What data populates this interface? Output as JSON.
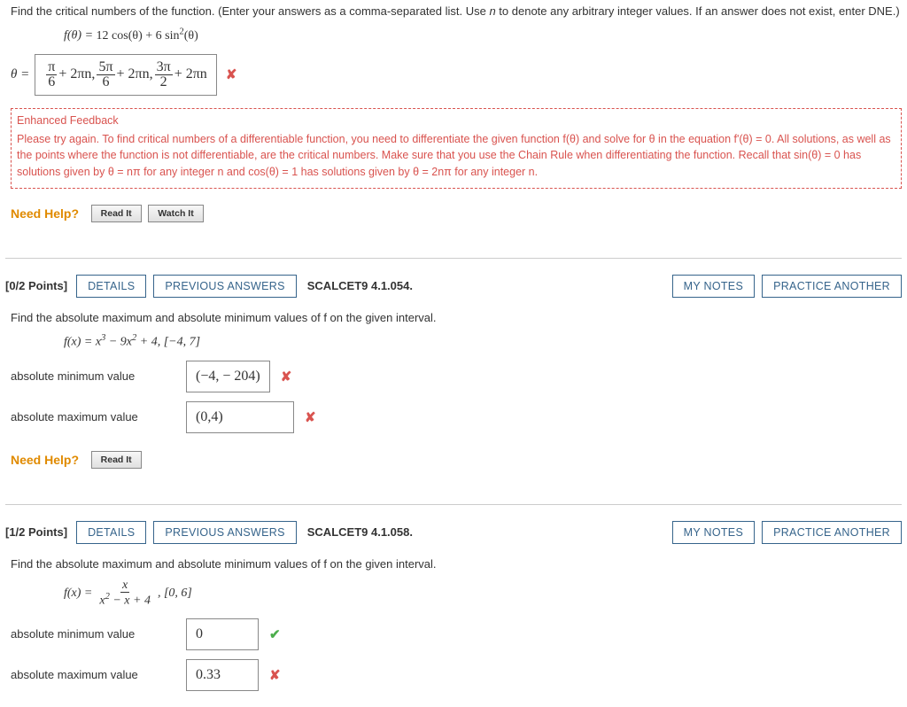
{
  "q1": {
    "prompt_a": "Find the critical numbers of the function. (Enter your answers as a comma-separated list. Use ",
    "prompt_n": "n",
    "prompt_b": " to denote any arbitrary integer values. If an answer does not exist, enter DNE.)",
    "func_fprefix": "f(θ) = ",
    "func_rest": "12 cos(θ) + 6 sin",
    "func_sup": "2",
    "func_tail": "(θ)",
    "theta_eq": "θ =",
    "ans_frac1_num": "π",
    "ans_frac1_den": "6",
    "ans_plus": " + 2πn, ",
    "ans_frac2_num": "5π",
    "ans_frac2_den": "6",
    "ans_frac3_num": "3π",
    "ans_frac3_den": "2",
    "ans_tail": " + 2πn",
    "feedback_title": "Enhanced Feedback",
    "feedback_body": "Please try again. To find critical numbers of a differentiable function, you need to differentiate the given function f(θ) and solve for θ in the equation f'(θ) = 0. All solutions, as well as the points where the function is not differentiable, are the critical numbers. Make sure that you use the Chain Rule when differentiating the function. Recall that sin(θ) = 0 has solutions given by θ = nπ for any integer n and cos(θ) = 1 has solutions given by θ = 2nπ for any integer n."
  },
  "help": {
    "label": "Need Help?",
    "read": "Read It",
    "watch": "Watch It"
  },
  "buttons": {
    "details": "DETAILS",
    "previous": "PREVIOUS ANSWERS",
    "notes": "MY NOTES",
    "practice": "PRACTICE ANOTHER"
  },
  "q2": {
    "points": "[0/2 Points]",
    "source": "SCALCET9 4.1.054.",
    "prompt": "Find the absolute maximum and absolute minimum values of f on the given interval.",
    "func_prefix": "f(x) = x",
    "func_sup1": "3",
    "func_mid": " − 9x",
    "func_sup2": "2",
    "func_tail": " + 4,    [−4, 7]",
    "min_label": "absolute minimum value",
    "max_label": "absolute maximum value",
    "min_value": "(−4, − 204)",
    "max_value": "(0,4)"
  },
  "q3": {
    "points": "[1/2 Points]",
    "source": "SCALCET9 4.1.058.",
    "prompt": "Find the absolute maximum and absolute minimum values of f on the given interval.",
    "func_lhs": "f(x) = ",
    "frac_num": "x",
    "frac_den_a": "x",
    "frac_den_sup": "2",
    "frac_den_b": " − x + 4",
    "interval": ",    [0, 6]",
    "min_label": "absolute minimum value",
    "max_label": "absolute maximum value",
    "min_value": "0",
    "max_value": "0.33"
  }
}
